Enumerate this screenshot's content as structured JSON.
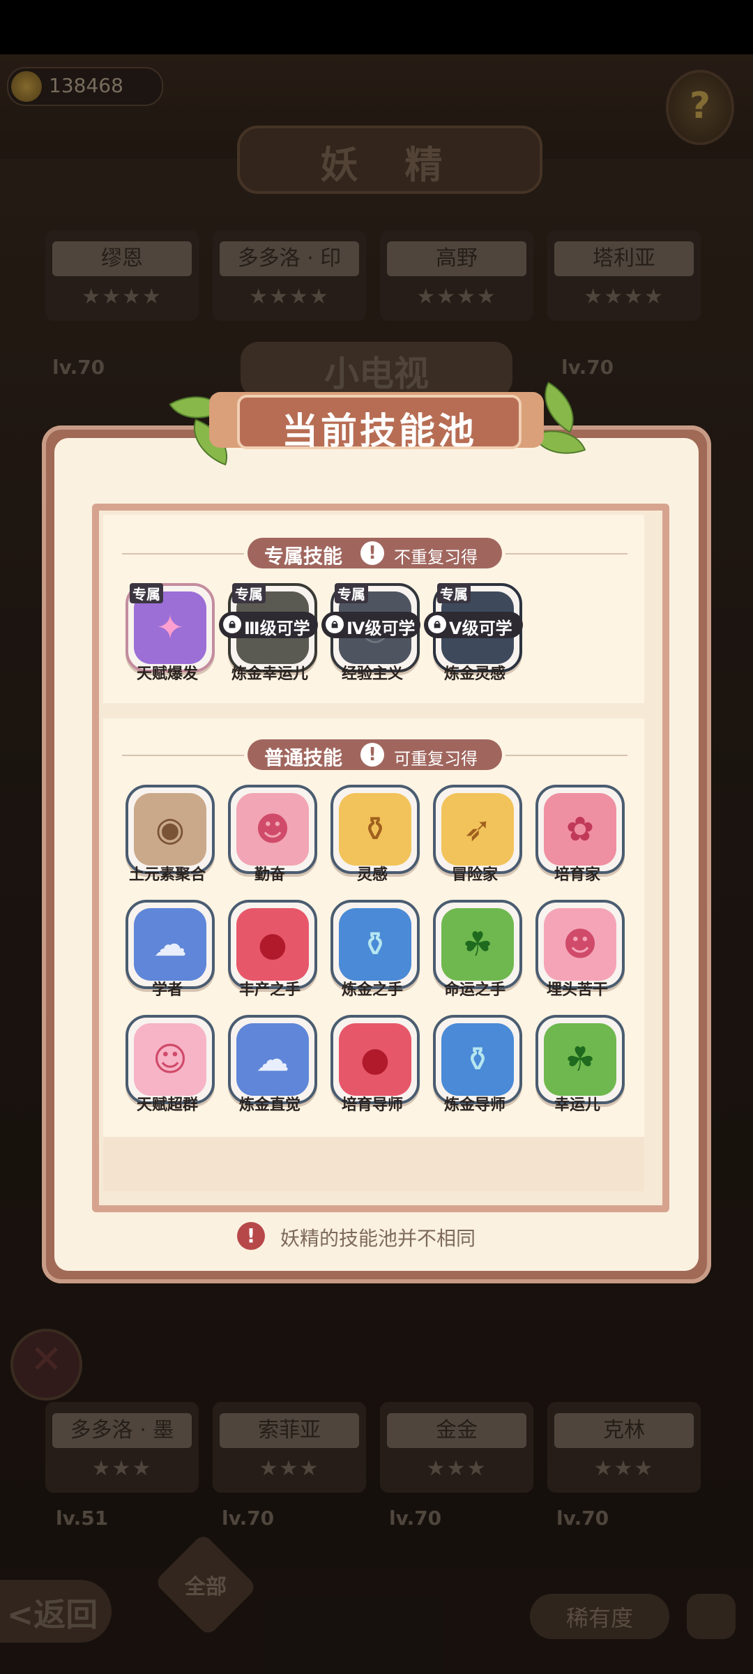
{
  "topbar": {
    "coins": "138468",
    "bg_title": "妖 精",
    "help": "?"
  },
  "bg_cards_top": [
    {
      "name": "缪恩",
      "stars": "★★★★"
    },
    {
      "name": "多多洛 · 印",
      "stars": "★★★★"
    },
    {
      "name": "高野",
      "stars": "★★★★"
    },
    {
      "name": "塔利亚",
      "stars": "★★★★"
    }
  ],
  "bg_level_label": "lv.70",
  "bg_subtitle": "小电视",
  "bg_cards_bottom": [
    {
      "name": "多多洛 · 墨",
      "stars": "★★★"
    },
    {
      "name": "索菲亚",
      "stars": "★★★"
    },
    {
      "name": "金金",
      "stars": "★★★"
    },
    {
      "name": "克林",
      "stars": "★★★"
    }
  ],
  "bg_levels_bottom": [
    "lv.51",
    "lv.70",
    "lv.70",
    "lv.70"
  ],
  "bottomnav": {
    "back": "<返回",
    "all": "全部",
    "rarity": "稀有度"
  },
  "modal": {
    "title": "当前技能池",
    "exclusive": {
      "header": "专属技能",
      "note": "不重复习得",
      "badge": "专属",
      "skills": [
        {
          "name": "天赋爆发",
          "lock": "",
          "color": "#9b6fd6",
          "glyph": "✦"
        },
        {
          "name": "炼金幸运儿",
          "lock": "Ⅲ级可学",
          "color": "#5a5a52",
          "glyph": "☘"
        },
        {
          "name": "经验主义",
          "lock": "Ⅳ级可学",
          "color": "#4f5560",
          "glyph": "◎"
        },
        {
          "name": "炼金灵感",
          "lock": "Ⅴ级可学",
          "color": "#3e4a5c",
          "glyph": "✧"
        }
      ]
    },
    "normal": {
      "header": "普通技能",
      "note": "可重复习得",
      "skills": [
        {
          "name": "土元素聚合",
          "color": "#caa98a",
          "glyph": "◉"
        },
        {
          "name": "勤奋",
          "color": "#f2a5b4",
          "glyph": "☻"
        },
        {
          "name": "灵感",
          "color": "#f2c35a",
          "glyph": "⚱"
        },
        {
          "name": "冒险家",
          "color": "#f2c35a",
          "glyph": "➶"
        },
        {
          "name": "培育家",
          "color": "#ef8fa2",
          "glyph": "✿"
        },
        {
          "name": "学者",
          "color": "#5f86d8",
          "glyph": "☁"
        },
        {
          "name": "丰产之手",
          "color": "#e7576a",
          "glyph": "●"
        },
        {
          "name": "炼金之手",
          "color": "#4a8ad6",
          "glyph": "⚱"
        },
        {
          "name": "命运之手",
          "color": "#6fb84f",
          "glyph": "☘"
        },
        {
          "name": "埋头苦干",
          "color": "#f5a4b8",
          "glyph": "☻"
        },
        {
          "name": "天赋超群",
          "color": "#f6b4c6",
          "glyph": "☺"
        },
        {
          "name": "炼金直觉",
          "color": "#5f86d8",
          "glyph": "☁"
        },
        {
          "name": "培育导师",
          "color": "#e7576a",
          "glyph": "●"
        },
        {
          "name": "炼金导师",
          "color": "#4a8ad6",
          "glyph": "⚱"
        },
        {
          "name": "幸运儿",
          "color": "#6fb84f",
          "glyph": "☘"
        }
      ]
    },
    "footnote": "妖精的技能池并不相同",
    "alert": "!"
  }
}
